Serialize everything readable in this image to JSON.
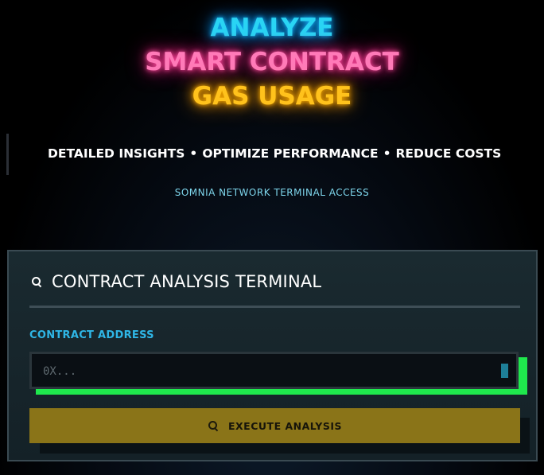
{
  "hero": {
    "line1": "ANALYZE",
    "line2": "SMART CONTRACT",
    "line3": "GAS USAGE"
  },
  "tagline": {
    "part1": "DETAILED INSIGHTS",
    "part2": "OPTIMIZE PERFORMANCE",
    "part3": "REDUCE COSTS",
    "separator": "•"
  },
  "subtag": "SOMNIA NETWORK TERMINAL ACCESS",
  "panel": {
    "title": "CONTRACT ANALYSIS TERMINAL",
    "field_label": "CONTRACT ADDRESS",
    "input_placeholder": "0X...",
    "input_value": "",
    "button_label": "EXECUTE ANALYSIS"
  },
  "icons": {
    "title_icon": "search-icon",
    "button_icon": "search-icon"
  },
  "colors": {
    "cyan": "#29d4f4",
    "pink": "#ff7ab8",
    "gold": "#ffc21c",
    "accent_green": "#1fe84d",
    "button_bg": "#8a7418",
    "label_blue": "#2fb6e6"
  }
}
